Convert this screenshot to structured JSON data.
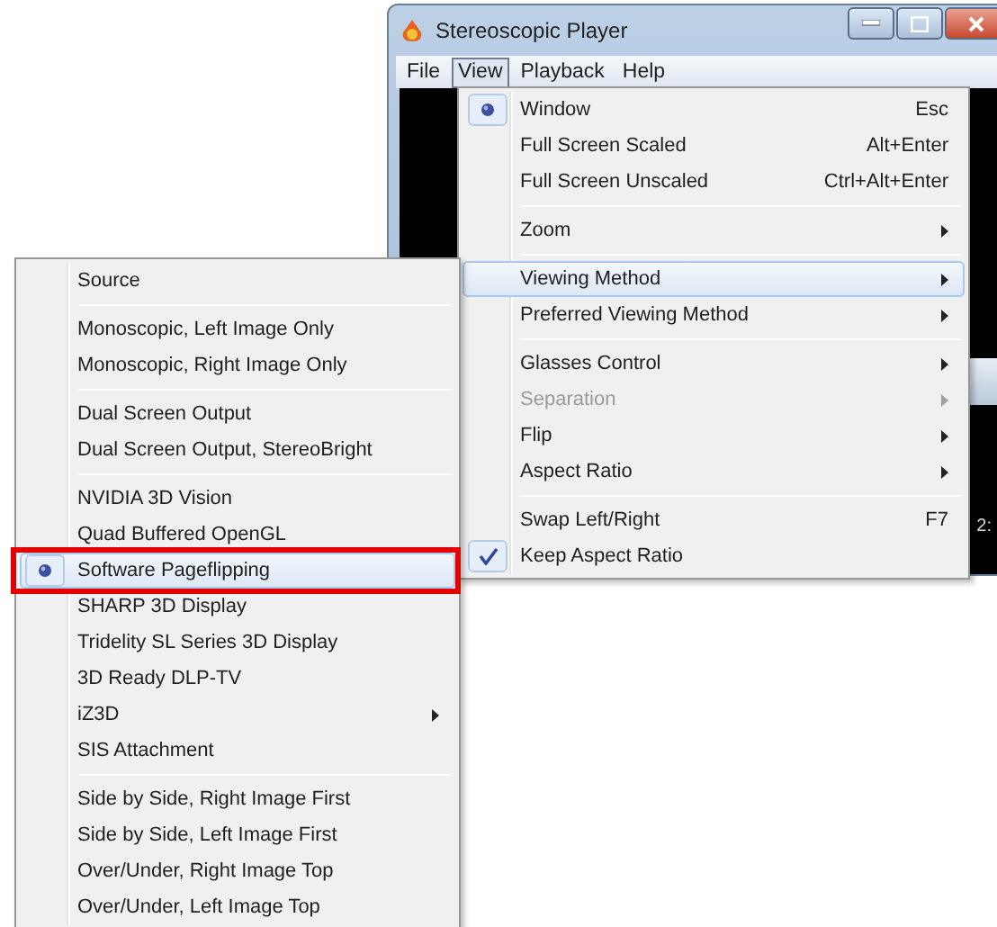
{
  "window": {
    "title": "Stereoscopic Player",
    "menu_bar": [
      {
        "label": "File",
        "selected": false
      },
      {
        "label": "View",
        "selected": true
      },
      {
        "label": "Playback",
        "selected": false
      },
      {
        "label": "Help",
        "selected": false
      }
    ],
    "time_text": "2:"
  },
  "view_menu": [
    {
      "kind": "radio",
      "label": "Window",
      "shortcut": "Esc",
      "checked": true,
      "selected": false,
      "disabled": false,
      "has_submenu": false,
      "outlined": false
    },
    {
      "kind": "radio",
      "label": "Full Screen Scaled",
      "shortcut": "Alt+Enter",
      "checked": false,
      "selected": false,
      "disabled": false,
      "has_submenu": false,
      "outlined": false
    },
    {
      "kind": "radio",
      "label": "Full Screen Unscaled",
      "shortcut": "Ctrl+Alt+Enter",
      "checked": false,
      "selected": false,
      "disabled": false,
      "has_submenu": false,
      "outlined": false
    },
    {
      "kind": "separator"
    },
    {
      "kind": "plain",
      "label": "Zoom",
      "checked": false,
      "selected": false,
      "disabled": false,
      "has_submenu": true,
      "outlined": false
    },
    {
      "kind": "separator"
    },
    {
      "kind": "plain",
      "label": "Viewing Method",
      "checked": false,
      "selected": true,
      "disabled": false,
      "has_submenu": true,
      "outlined": false
    },
    {
      "kind": "plain",
      "label": "Preferred Viewing Method",
      "checked": false,
      "selected": false,
      "disabled": false,
      "has_submenu": true,
      "outlined": false
    },
    {
      "kind": "separator"
    },
    {
      "kind": "plain",
      "label": "Glasses Control",
      "checked": false,
      "selected": false,
      "disabled": false,
      "has_submenu": true,
      "outlined": false
    },
    {
      "kind": "plain",
      "label": "Separation",
      "checked": false,
      "selected": false,
      "disabled": true,
      "has_submenu": true,
      "outlined": false
    },
    {
      "kind": "plain",
      "label": "Flip",
      "checked": false,
      "selected": false,
      "disabled": false,
      "has_submenu": true,
      "outlined": false
    },
    {
      "kind": "plain",
      "label": "Aspect Ratio",
      "checked": false,
      "selected": false,
      "disabled": false,
      "has_submenu": true,
      "outlined": false
    },
    {
      "kind": "separator"
    },
    {
      "kind": "check",
      "label": "Swap Left/Right",
      "shortcut": "F7",
      "checked": false,
      "selected": false,
      "disabled": false,
      "has_submenu": false,
      "outlined": false
    },
    {
      "kind": "check",
      "label": "Keep Aspect Ratio",
      "checked": true,
      "selected": false,
      "disabled": false,
      "has_submenu": false,
      "outlined": false
    }
  ],
  "viewing_method_menu": [
    {
      "kind": "radio",
      "label": "Source",
      "checked": false,
      "selected": false,
      "disabled": false,
      "has_submenu": false,
      "outlined": false
    },
    {
      "kind": "separator"
    },
    {
      "kind": "radio",
      "label": "Monoscopic, Left Image Only",
      "checked": false,
      "selected": false,
      "disabled": false,
      "has_submenu": false,
      "outlined": false
    },
    {
      "kind": "radio",
      "label": "Monoscopic, Right Image Only",
      "checked": false,
      "selected": false,
      "disabled": false,
      "has_submenu": false,
      "outlined": false
    },
    {
      "kind": "separator"
    },
    {
      "kind": "radio",
      "label": "Dual Screen Output",
      "checked": false,
      "selected": false,
      "disabled": false,
      "has_submenu": false,
      "outlined": false
    },
    {
      "kind": "radio",
      "label": "Dual Screen Output, StereoBright",
      "checked": false,
      "selected": false,
      "disabled": false,
      "has_submenu": false,
      "outlined": false
    },
    {
      "kind": "separator"
    },
    {
      "kind": "radio",
      "label": "NVIDIA 3D Vision",
      "checked": false,
      "selected": false,
      "disabled": false,
      "has_submenu": false,
      "outlined": false
    },
    {
      "kind": "radio",
      "label": "Quad Buffered OpenGL",
      "checked": false,
      "selected": false,
      "disabled": false,
      "has_submenu": false,
      "outlined": false
    },
    {
      "kind": "radio",
      "label": "Software Pageflipping",
      "checked": true,
      "selected": true,
      "disabled": false,
      "has_submenu": false,
      "outlined": true
    },
    {
      "kind": "radio",
      "label": "SHARP 3D Display",
      "checked": false,
      "selected": false,
      "disabled": false,
      "has_submenu": false,
      "outlined": false
    },
    {
      "kind": "radio",
      "label": "Tridelity SL Series 3D Display",
      "checked": false,
      "selected": false,
      "disabled": false,
      "has_submenu": false,
      "outlined": false
    },
    {
      "kind": "radio",
      "label": "3D Ready DLP-TV",
      "checked": false,
      "selected": false,
      "disabled": false,
      "has_submenu": false,
      "outlined": false
    },
    {
      "kind": "radio",
      "label": "iZ3D",
      "checked": false,
      "selected": false,
      "disabled": false,
      "has_submenu": true,
      "outlined": false
    },
    {
      "kind": "radio",
      "label": "SIS Attachment",
      "checked": false,
      "selected": false,
      "disabled": false,
      "has_submenu": false,
      "outlined": false
    },
    {
      "kind": "separator"
    },
    {
      "kind": "radio",
      "label": "Side by Side, Right Image First",
      "checked": false,
      "selected": false,
      "disabled": false,
      "has_submenu": false,
      "outlined": false
    },
    {
      "kind": "radio",
      "label": "Side by Side, Left Image First",
      "checked": false,
      "selected": false,
      "disabled": false,
      "has_submenu": false,
      "outlined": false
    },
    {
      "kind": "radio",
      "label": "Over/Under, Right Image Top",
      "checked": false,
      "selected": false,
      "disabled": false,
      "has_submenu": false,
      "outlined": false
    },
    {
      "kind": "radio",
      "label": "Over/Under, Left Image Top",
      "checked": false,
      "selected": false,
      "disabled": false,
      "has_submenu": false,
      "outlined": false
    }
  ]
}
